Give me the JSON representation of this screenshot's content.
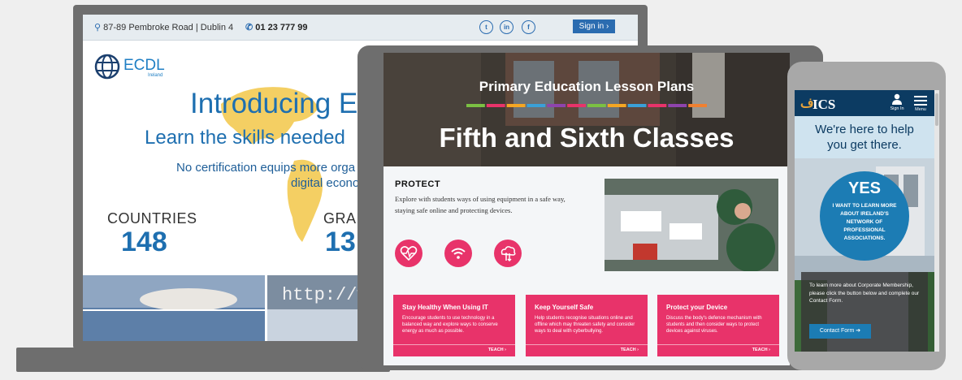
{
  "laptop": {
    "topbar": {
      "address_icon": "map-pin-icon",
      "address": "87-89 Pembroke Road | Dublin 4",
      "phone_icon": "phone-icon",
      "phone": "01 23 777 99",
      "social": [
        {
          "name": "twitter-icon",
          "glyph": "t"
        },
        {
          "name": "linkedin-icon",
          "glyph": "in"
        },
        {
          "name": "facebook-icon",
          "glyph": "f"
        }
      ],
      "signin": "Sign in ›"
    },
    "logo": {
      "brand": "ECDL",
      "sub": "Ireland"
    },
    "hero": {
      "title": "Introducing E",
      "subtitle": "Learn the skills needed",
      "body_line1": "No certification equips more orga",
      "body_line2": "digital econo"
    },
    "stats": [
      {
        "label": "COUNTRIES",
        "value": "148"
      },
      {
        "label": "GRAD",
        "value": "13"
      }
    ],
    "photo_text": "http://ww"
  },
  "tablet": {
    "heading": "Primary Education Lesson Plans",
    "title": "Fifth and Sixth Classes",
    "stripe_colors": [
      "#7bc043",
      "#e8336a",
      "#f5a623",
      "#3aa0d8",
      "#8e44ad",
      "#e8336a",
      "#7bc043",
      "#f5a623",
      "#3aa0d8",
      "#e8336a",
      "#8e44ad",
      "#f08030"
    ],
    "protect_title": "PROTECT",
    "protect_text": "Explore with students ways of using equipment in a safe way, staying safe online and protecting devices.",
    "icons": [
      "heart-monitor-icon",
      "wifi-icon",
      "cloud-transfer-icon"
    ],
    "cards": [
      {
        "title": "Stay Healthy When Using IT",
        "body": "Encourage students to use technology in a balanced way and explore ways to conserve energy as much as possible.",
        "cta": "TEACH ›"
      },
      {
        "title": "Keep Yourself Safe",
        "body": "Help students recognise situations online and offline which may threaten safety and consider ways to deal with cyberbullying.",
        "cta": "TEACH ›"
      },
      {
        "title": "Protect your Device",
        "body": "Discuss the body's defence mechanism with students and then consider ways to protect devices against viruses.",
        "cta": "TEACH ›"
      }
    ],
    "accent": "#e8336a"
  },
  "phone": {
    "logo": "ICS",
    "signin": "Sign In",
    "menu": "Menu",
    "tagline_line1": "We're here to help",
    "tagline_line2": "you get there.",
    "yes": "YES",
    "yes_text": "I WANT TO LEARN MORE ABOUT IRELAND'S NETWORK OF PROFESSIONAL ASSOCIATIONS.",
    "overlay_text": "To learn more about Corporate Membership, please click the button below and complete our Contact Form.",
    "button": "Contact Form ➔",
    "accent": "#1c7cb4",
    "header_color": "#0c3b62"
  }
}
